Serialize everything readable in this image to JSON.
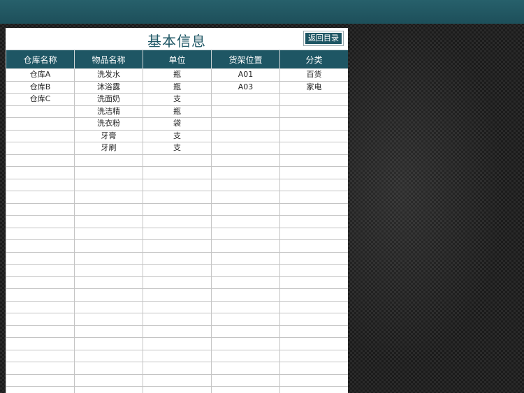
{
  "sheet": {
    "title": "基本信息",
    "back_button": "返回目录",
    "columns": [
      "仓库名称",
      "物品名称",
      "单位",
      "货架位置",
      "分类"
    ],
    "rows": [
      [
        "仓库A",
        "洗发水",
        "瓶",
        "A01",
        "百货"
      ],
      [
        "仓库B",
        "沐浴露",
        "瓶",
        "A03",
        "家电"
      ],
      [
        "仓库C",
        "洗面奶",
        "支",
        "",
        ""
      ],
      [
        "",
        "洗洁精",
        "瓶",
        "",
        ""
      ],
      [
        "",
        "洗衣粉",
        "袋",
        "",
        ""
      ],
      [
        "",
        "牙膏",
        "支",
        "",
        ""
      ],
      [
        "",
        "牙刷",
        "支",
        "",
        ""
      ],
      [
        "",
        "",
        "",
        "",
        ""
      ],
      [
        "",
        "",
        "",
        "",
        ""
      ],
      [
        "",
        "",
        "",
        "",
        ""
      ],
      [
        "",
        "",
        "",
        "",
        ""
      ],
      [
        "",
        "",
        "",
        "",
        ""
      ],
      [
        "",
        "",
        "",
        "",
        ""
      ],
      [
        "",
        "",
        "",
        "",
        ""
      ],
      [
        "",
        "",
        "",
        "",
        ""
      ],
      [
        "",
        "",
        "",
        "",
        ""
      ],
      [
        "",
        "",
        "",
        "",
        ""
      ],
      [
        "",
        "",
        "",
        "",
        ""
      ],
      [
        "",
        "",
        "",
        "",
        ""
      ],
      [
        "",
        "",
        "",
        "",
        ""
      ],
      [
        "",
        "",
        "",
        "",
        ""
      ],
      [
        "",
        "",
        "",
        "",
        ""
      ],
      [
        "",
        "",
        "",
        "",
        ""
      ],
      [
        "",
        "",
        "",
        "",
        ""
      ],
      [
        "",
        "",
        "",
        "",
        ""
      ],
      [
        "",
        "",
        "",
        "",
        ""
      ],
      [
        "",
        "",
        "",
        "",
        ""
      ],
      [
        "",
        "",
        "",
        "",
        ""
      ]
    ]
  },
  "colors": {
    "header_bg": "#1e5664",
    "topbar_bg": "#27606b",
    "title_text": "#1f5765"
  }
}
